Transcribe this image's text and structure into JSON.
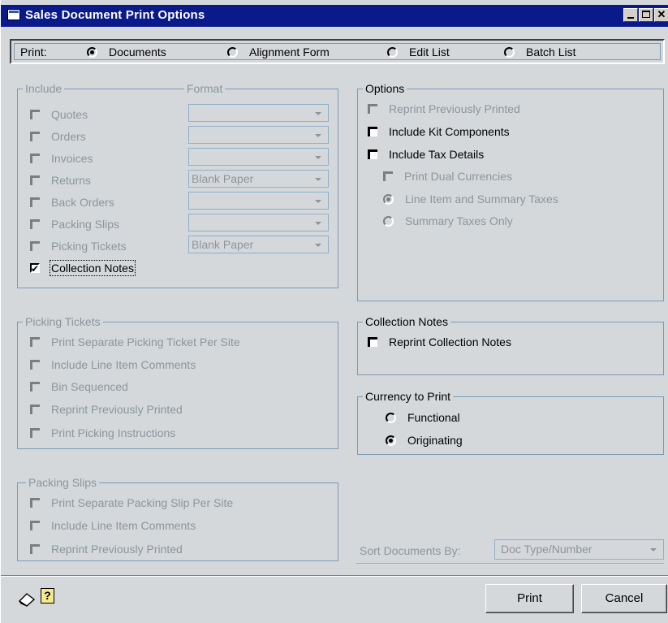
{
  "window": {
    "title": "Sales Document Print Options"
  },
  "print": {
    "label": "Print:",
    "options": [
      {
        "label": "Documents",
        "selected": true
      },
      {
        "label": "Alignment Form",
        "selected": false
      },
      {
        "label": "Edit List",
        "selected": false
      },
      {
        "label": "Batch List",
        "selected": false
      }
    ]
  },
  "include": {
    "legend": "Include",
    "format_legend": "Format",
    "items": [
      {
        "label": "Quotes",
        "checked": false,
        "format": ""
      },
      {
        "label": "Orders",
        "checked": false,
        "format": ""
      },
      {
        "label": "Invoices",
        "checked": false,
        "format": ""
      },
      {
        "label": "Returns",
        "checked": false,
        "format": "Blank Paper"
      },
      {
        "label": "Back Orders",
        "checked": false,
        "format": ""
      },
      {
        "label": "Packing Slips",
        "checked": false,
        "format": ""
      },
      {
        "label": "Picking Tickets",
        "checked": false,
        "format": "Blank Paper"
      },
      {
        "label": "Collection Notes",
        "checked": true
      }
    ]
  },
  "options": {
    "legend": "Options",
    "reprint": "Reprint Previously Printed",
    "kit": "Include Kit Components",
    "tax": "Include Tax Details",
    "dual": "Print Dual Currencies",
    "line_summary": "Line Item and Summary Taxes",
    "summary_only": "Summary Taxes Only"
  },
  "picking": {
    "legend": "Picking Tickets",
    "items": [
      "Print Separate Picking Ticket Per Site",
      "Include Line Item Comments",
      "Bin Sequenced",
      "Reprint Previously Printed",
      "Print Picking Instructions"
    ]
  },
  "collection": {
    "legend": "Collection Notes",
    "reprint": "Reprint Collection Notes"
  },
  "currency": {
    "legend": "Currency to Print",
    "functional": "Functional",
    "originating": "Originating",
    "selected": "Originating"
  },
  "packing": {
    "legend": "Packing Slips",
    "items": [
      "Print Separate Packing Slip Per Site",
      "Include Line Item Comments",
      "Reprint Previously Printed"
    ]
  },
  "sort": {
    "label": "Sort Documents By:",
    "value": "Doc Type/Number"
  },
  "buttons": {
    "print": "Print",
    "cancel": "Cancel"
  },
  "icons": {
    "help": "?"
  }
}
